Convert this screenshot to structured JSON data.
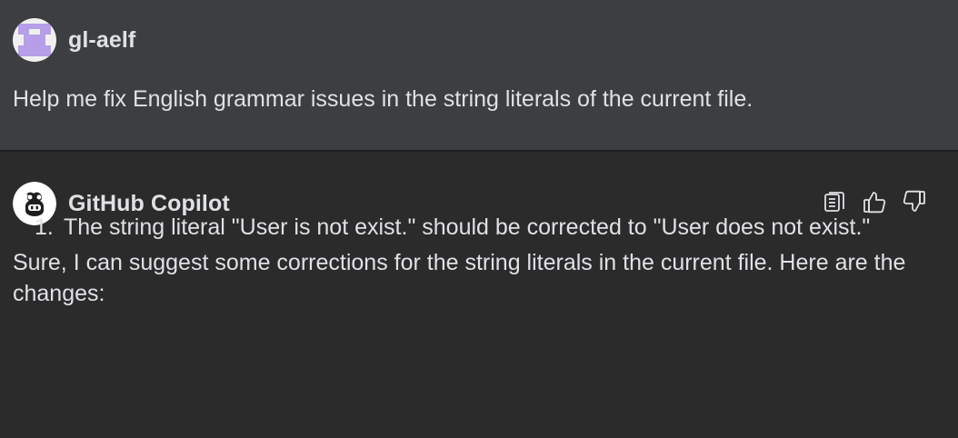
{
  "user_message": {
    "author": "gl-aelf",
    "avatar_icon": "identicon-avatar",
    "avatar_color": "#b69ee8",
    "text": "Help me fix English grammar issues in the string literals of the current file."
  },
  "assistant_message": {
    "author": "GitHub Copilot",
    "avatar_icon": "copilot-icon",
    "actions": [
      {
        "icon": "copy-code-icon"
      },
      {
        "icon": "thumbs-up-icon"
      },
      {
        "icon": "thumbs-down-icon"
      }
    ],
    "intro": "Sure, I can suggest some corrections for the string literals in the current file. Here are the changes:",
    "items": [
      {
        "number": "1.",
        "text": "The string literal \"User is not exist.\" should be corrected to \"User does not exist.\""
      }
    ]
  },
  "colors": {
    "user_background": "#3d3e42",
    "assistant_background": "#2b2b2c",
    "text": "#dfe1e5"
  }
}
